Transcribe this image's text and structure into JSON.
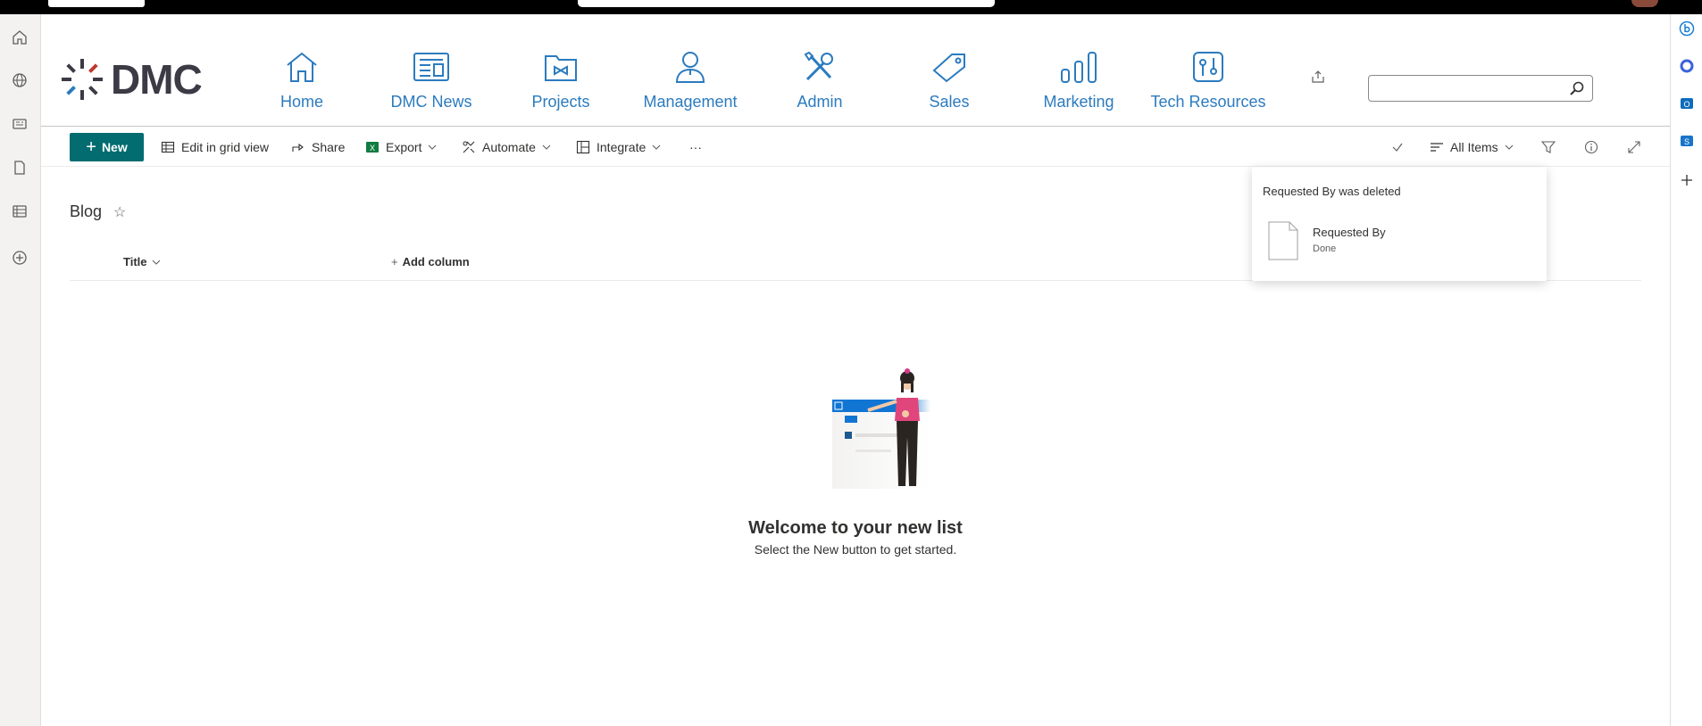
{
  "hub": {
    "brand": "DMC",
    "nav": [
      {
        "label": "Home",
        "icon": "home-icon"
      },
      {
        "label": "DMC News",
        "icon": "news-icon"
      },
      {
        "label": "Projects",
        "icon": "projects-folder-icon"
      },
      {
        "label": "Management",
        "icon": "person-icon"
      },
      {
        "label": "Admin",
        "icon": "tools-icon"
      },
      {
        "label": "Sales",
        "icon": "tag-icon"
      },
      {
        "label": "Marketing",
        "icon": "bar-chart-icon"
      },
      {
        "label": "Tech Resources",
        "icon": "tech-resources-icon"
      }
    ],
    "search": {
      "placeholder": "",
      "value": ""
    }
  },
  "command_bar": {
    "new": "New",
    "edit_grid": "Edit in grid view",
    "share": "Share",
    "export": "Export",
    "automate": "Automate",
    "integrate": "Integrate",
    "more": "···",
    "view": "All Items"
  },
  "list": {
    "title": "Blog",
    "columns": {
      "title": "Title",
      "add": "Add column"
    },
    "empty": {
      "heading": "Welcome to your new list",
      "subtext": "Select the New button to get started."
    }
  },
  "notification": {
    "message": "Requested By was deleted",
    "item_name": "Requested By",
    "item_status": "Done"
  },
  "colors": {
    "accent": "#036c70",
    "nav_text": "#2b7bbf",
    "logo_dark": "#3b3a45"
  }
}
